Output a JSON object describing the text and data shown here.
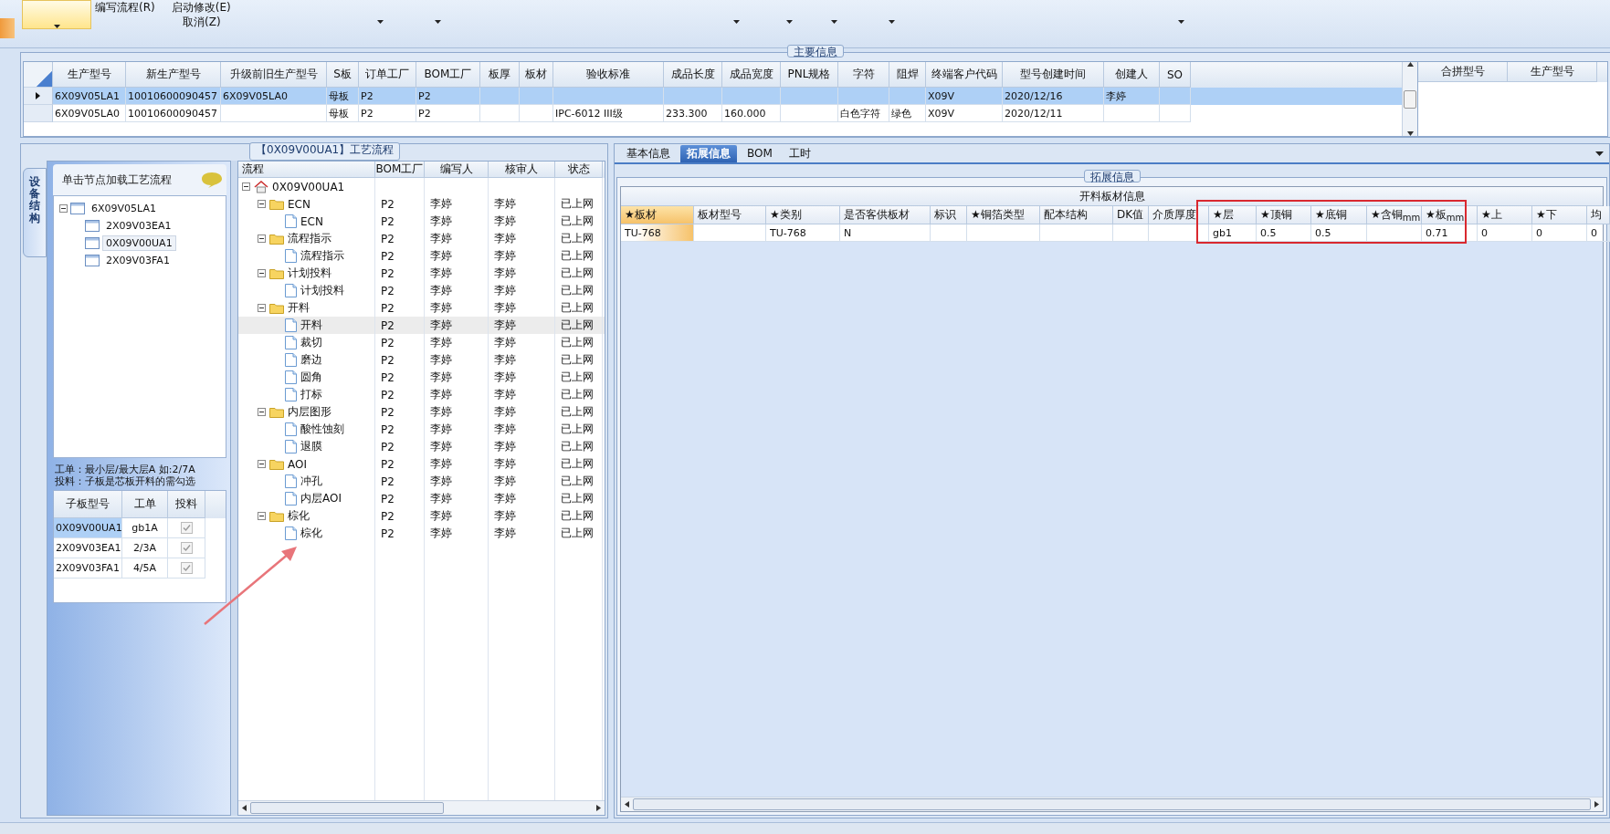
{
  "ribbon": {
    "menu_items": [
      {
        "label": "编写流程(R)"
      },
      {
        "label": "启动修改(E)"
      },
      {
        "label": "取消(Z)"
      }
    ]
  },
  "main_info": {
    "title": "主要信息",
    "columns": [
      "生产型号",
      "新生产型号",
      "升级前旧生产型号",
      "S板",
      "订单工厂",
      "BOM工厂",
      "板厚",
      "板材",
      "验收标准",
      "成品长度",
      "成品宽度",
      "PNL规格",
      "字符",
      "阻焊",
      "终端客户代码",
      "型号创建时间",
      "创建人",
      "SO"
    ],
    "rows": [
      {
        "selected": true,
        "cells": [
          "6X09V05LA1",
          "10010600090457",
          "6X09V05LA0",
          "母板",
          "P2",
          "P2",
          null,
          null,
          null,
          null,
          null,
          null,
          null,
          null,
          "X09V",
          "2020/12/16",
          "李婷",
          null
        ]
      },
      {
        "selected": false,
        "cells": [
          "6X09V05LA0",
          "10010600090457",
          null,
          "母板",
          "P2",
          "P2",
          null,
          null,
          "IPC-6012 III级",
          "233.300",
          "160.000",
          null,
          "白色字符",
          "绿色",
          "X09V",
          "2020/12/11",
          null,
          null
        ]
      }
    ],
    "merge_columns": [
      "合拼型号",
      "生产型号"
    ]
  },
  "process_panel": {
    "title": "【0X09V00UA1】工艺流程",
    "side_tab": "设备结构",
    "hint": "单击节点加载工艺流程",
    "board_tree": [
      {
        "label": "6X09V05LA1",
        "expanded": true,
        "selected": false,
        "children": [
          {
            "label": "2X09V03EA1",
            "selected": false
          },
          {
            "label": "0X09V00UA1",
            "selected": true
          },
          {
            "label": "2X09V03FA1",
            "selected": false
          }
        ]
      }
    ],
    "notes": [
      "工单：最小层/最大层A 如:2/7A",
      "投料：子板是芯板开料的需勾选"
    ],
    "sub_boards": {
      "columns": [
        "子板型号",
        "工单",
        "投料"
      ],
      "rows": [
        {
          "model": "0X09V00UA1",
          "order": "gb1A",
          "feed": true,
          "selected": true
        },
        {
          "model": "2X09V03EA1",
          "order": "2/3A",
          "feed": true,
          "selected": false
        },
        {
          "model": "2X09V03FA1",
          "order": "4/5A",
          "feed": true,
          "selected": false
        }
      ]
    },
    "flow": {
      "columns": [
        "流程",
        "BOM工厂",
        "编写人",
        "核审人",
        "状态"
      ],
      "tree": [
        {
          "kind": "home",
          "label": "0X09V00UA1",
          "expanded": true,
          "selected": false,
          "children": [
            {
              "kind": "folder",
              "label": "ECN",
              "bom": "P2",
              "writer": "李婷",
              "reviewer": "李婷",
              "status": "已上网",
              "expanded": true,
              "selected": false,
              "children": [
                {
                  "kind": "page",
                  "label": "ECN",
                  "bom": "P2",
                  "writer": "李婷",
                  "reviewer": "李婷",
                  "status": "已上网",
                  "selected": false
                }
              ]
            },
            {
              "kind": "folder",
              "label": "流程指示",
              "bom": "P2",
              "writer": "李婷",
              "reviewer": "李婷",
              "status": "已上网",
              "expanded": true,
              "selected": false,
              "children": [
                {
                  "kind": "page",
                  "label": "流程指示",
                  "bom": "P2",
                  "writer": "李婷",
                  "reviewer": "李婷",
                  "status": "已上网",
                  "selected": false
                }
              ]
            },
            {
              "kind": "folder",
              "label": "计划投料",
              "bom": "P2",
              "writer": "李婷",
              "reviewer": "李婷",
              "status": "已上网",
              "expanded": true,
              "selected": false,
              "children": [
                {
                  "kind": "page",
                  "label": "计划投料",
                  "bom": "P2",
                  "writer": "李婷",
                  "reviewer": "李婷",
                  "status": "已上网",
                  "selected": false
                }
              ]
            },
            {
              "kind": "folder",
              "label": "开料",
              "bom": "P2",
              "writer": "李婷",
              "reviewer": "李婷",
              "status": "已上网",
              "expanded": true,
              "selected": false,
              "children": [
                {
                  "kind": "page",
                  "label": "开料",
                  "bom": "P2",
                  "writer": "李婷",
                  "reviewer": "李婷",
                  "status": "已上网",
                  "selected": true
                },
                {
                  "kind": "page",
                  "label": "裁切",
                  "bom": "P2",
                  "writer": "李婷",
                  "reviewer": "李婷",
                  "status": "已上网",
                  "selected": false
                },
                {
                  "kind": "page",
                  "label": "磨边",
                  "bom": "P2",
                  "writer": "李婷",
                  "reviewer": "李婷",
                  "status": "已上网",
                  "selected": false
                },
                {
                  "kind": "page",
                  "label": "圆角",
                  "bom": "P2",
                  "writer": "李婷",
                  "reviewer": "李婷",
                  "status": "已上网",
                  "selected": false
                },
                {
                  "kind": "page",
                  "label": "打标",
                  "bom": "P2",
                  "writer": "李婷",
                  "reviewer": "李婷",
                  "status": "已上网",
                  "selected": false
                }
              ]
            },
            {
              "kind": "folder",
              "label": "内层图形",
              "bom": "P2",
              "writer": "李婷",
              "reviewer": "李婷",
              "status": "已上网",
              "expanded": true,
              "selected": false,
              "children": [
                {
                  "kind": "page",
                  "label": "酸性蚀刻",
                  "bom": "P2",
                  "writer": "李婷",
                  "reviewer": "李婷",
                  "status": "已上网",
                  "selected": false
                },
                {
                  "kind": "page",
                  "label": "退膜",
                  "bom": "P2",
                  "writer": "李婷",
                  "reviewer": "李婷",
                  "status": "已上网",
                  "selected": false
                }
              ]
            },
            {
              "kind": "folder",
              "label": "AOI",
              "bom": "P2",
              "writer": "李婷",
              "reviewer": "李婷",
              "status": "已上网",
              "expanded": true,
              "selected": false,
              "children": [
                {
                  "kind": "page",
                  "label": "冲孔",
                  "bom": "P2",
                  "writer": "李婷",
                  "reviewer": "李婷",
                  "status": "已上网",
                  "selected": false
                },
                {
                  "kind": "page",
                  "label": "内层AOI",
                  "bom": "P2",
                  "writer": "李婷",
                  "reviewer": "李婷",
                  "status": "已上网",
                  "selected": false
                }
              ]
            },
            {
              "kind": "folder",
              "label": "棕化",
              "bom": "P2",
              "writer": "李婷",
              "reviewer": "李婷",
              "status": "已上网",
              "expanded": true,
              "selected": false,
              "children": [
                {
                  "kind": "page",
                  "label": "棕化",
                  "bom": "P2",
                  "writer": "李婷",
                  "reviewer": "李婷",
                  "status": "已上网",
                  "selected": false
                }
              ]
            }
          ]
        }
      ]
    }
  },
  "detail_panel": {
    "tabs": [
      {
        "label": "基本信息",
        "selected": false
      },
      {
        "label": "拓展信息",
        "selected": true
      },
      {
        "label": "BOM",
        "selected": false
      },
      {
        "label": "工时",
        "selected": false
      }
    ],
    "group_title": "拓展信息",
    "grid_title": "开料板材信息",
    "columns": [
      {
        "label": "★板材",
        "active": true
      },
      {
        "label": "板材型号",
        "active": false
      },
      {
        "label": "★类别",
        "active": false
      },
      {
        "label": "是否客供板材",
        "active": false
      },
      {
        "label": "标识",
        "active": false
      },
      {
        "label": "★铜箔类型",
        "active": false
      },
      {
        "label": "配本结构",
        "active": false
      },
      {
        "label": "DK值",
        "active": false
      },
      {
        "label": "介质厚度",
        "active": false
      },
      {
        "label": "★层",
        "active": false
      },
      {
        "label": "★顶铜",
        "active": false
      },
      {
        "label": "★底铜",
        "active": false
      },
      {
        "label": "★含铜$_{mm}$",
        "active": false
      },
      {
        "label": "★板$_{mm}$",
        "active": false
      },
      {
        "label": "★上",
        "active": false
      },
      {
        "label": "★下",
        "active": false
      },
      {
        "label": "均",
        "active": false
      }
    ],
    "rows": [
      {
        "cells": [
          "TU-768",
          null,
          "TU-768",
          "N",
          null,
          null,
          null,
          null,
          null,
          "gb1",
          "0.5",
          "0.5",
          null,
          "0.71",
          "0",
          "0",
          "0"
        ]
      }
    ]
  }
}
